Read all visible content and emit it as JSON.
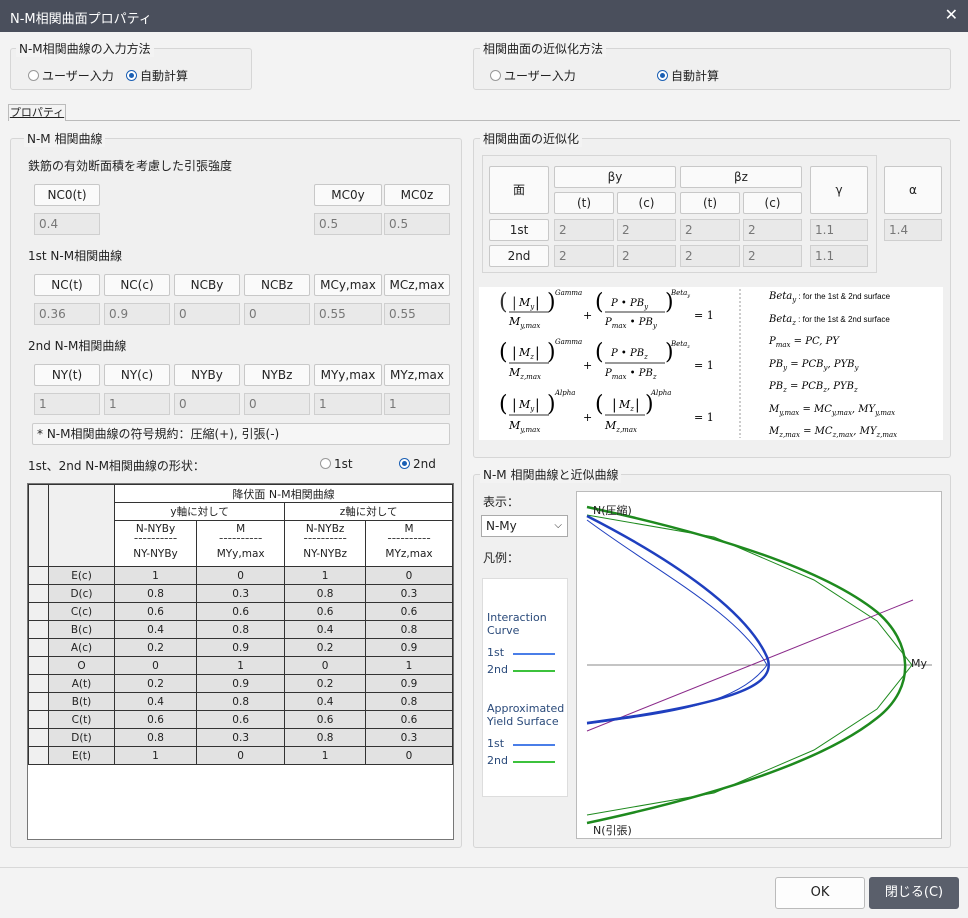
{
  "window": {
    "title": "N-M相関曲面プロパティ",
    "close_glyph": "✕"
  },
  "input_method": {
    "legend": "N-M相関曲線の入力方法",
    "opt_user": "ユーザー入力",
    "opt_auto": "自動計算"
  },
  "approx_method": {
    "legend": "相関曲面の近似化方法",
    "opt_user": "ユーザー入力",
    "opt_auto": "自動計算"
  },
  "tab": {
    "label": "プロパティ"
  },
  "nm_curve": {
    "legend": "N-M 相関曲線",
    "tension_label": "鉄筋の有効断面積を考慮した引張強度",
    "tension_headers": [
      "NC0(t)",
      "MC0y",
      "MC0z"
    ],
    "tension_values": [
      "0.4",
      "0.5",
      "0.5"
    ],
    "first_label": "1st N-M相関曲線",
    "first_headers": [
      "NC(t)",
      "NC(c)",
      "NCBy",
      "NCBz",
      "MCy,max",
      "MCz,max"
    ],
    "first_values": [
      "0.36",
      "0.9",
      "0",
      "0",
      "0.55",
      "0.55"
    ],
    "second_label": "2nd N-M相関曲線",
    "second_headers": [
      "NY(t)",
      "NY(c)",
      "NYBy",
      "NYBz",
      "MYy,max",
      "MYz,max"
    ],
    "second_values": [
      "1",
      "1",
      "0",
      "0",
      "1",
      "1"
    ],
    "sign_note": "* N-M相関曲線の符号規約：圧縮(+),  引張(-)",
    "shape_label": "1st、2nd N-M相関曲線の形状：",
    "shape_opt1": "1st",
    "shape_opt2": "2nd"
  },
  "table": {
    "title": "降伏面 N-M相関曲線",
    "y_axis": "y軸に対して",
    "z_axis": "z軸に対して",
    "col1_top": "N-NYBy",
    "col1_bot": "NY-NYBy",
    "col2_top": "M",
    "col2_bot": "MYy,max",
    "col3_top": "N-NYBz",
    "col3_bot": "NY-NYBz",
    "col4_top": "M",
    "col4_bot": "MYz,max",
    "dashes": "----------",
    "rows": [
      {
        "label": "E(c)",
        "v": [
          "1",
          "0",
          "1",
          "0"
        ]
      },
      {
        "label": "D(c)",
        "v": [
          "0.8",
          "0.3",
          "0.8",
          "0.3"
        ]
      },
      {
        "label": "C(c)",
        "v": [
          "0.6",
          "0.6",
          "0.6",
          "0.6"
        ]
      },
      {
        "label": "B(c)",
        "v": [
          "0.4",
          "0.8",
          "0.4",
          "0.8"
        ]
      },
      {
        "label": "A(c)",
        "v": [
          "0.2",
          "0.9",
          "0.2",
          "0.9"
        ]
      },
      {
        "label": "O",
        "v": [
          "0",
          "1",
          "0",
          "1"
        ]
      },
      {
        "label": "A(t)",
        "v": [
          "0.2",
          "0.9",
          "0.2",
          "0.9"
        ]
      },
      {
        "label": "B(t)",
        "v": [
          "0.4",
          "0.8",
          "0.4",
          "0.8"
        ]
      },
      {
        "label": "C(t)",
        "v": [
          "0.6",
          "0.6",
          "0.6",
          "0.6"
        ]
      },
      {
        "label": "D(t)",
        "v": [
          "0.8",
          "0.3",
          "0.8",
          "0.3"
        ]
      },
      {
        "label": "E(t)",
        "v": [
          "1",
          "0",
          "1",
          "0"
        ]
      }
    ]
  },
  "approx": {
    "legend": "相関曲面の近似化",
    "face": "面",
    "by": "βy",
    "bz": "βz",
    "gamma": "γ",
    "alpha": "α",
    "t": "(t)",
    "c": "(c)",
    "row1_label": "1st",
    "row2_label": "2nd",
    "row1": [
      "2",
      "2",
      "2",
      "2",
      "1.1"
    ],
    "row2": [
      "2",
      "2",
      "2",
      "2",
      "1.1"
    ],
    "alpha_val": "1.4"
  },
  "formula": {
    "eq_rhs": "= 1",
    "gamma": "Gamma",
    "alpha": "Alpha",
    "defs": [
      {
        "sym": "Beta",
        "sub": "y",
        "txt": ": for the 1st & 2nd surface"
      },
      {
        "sym": "Beta",
        "sub": "z",
        "txt": ": for the 1st & 2nd surface"
      }
    ],
    "def3": "P",
    "def3_sub": "max",
    "def3_rhs": "= PC,  PY",
    "def4": "PB",
    "def4_sub": "y",
    "def4_rhs": "= PCB",
    "def5": "PB",
    "def5_sub": "z",
    "def5_rhs": "= PCB",
    "def6": "M",
    "def6_sub": "y,max",
    "def6_rhs": "= MC",
    "def7": "M",
    "def7_sub": "z,max",
    "def7_rhs": "= MC"
  },
  "plot": {
    "legend": "N-M 相関曲線と近似曲線",
    "display_label": "表示：",
    "display_value": "N-My",
    "legend_label": "凡例：",
    "interaction": "Interaction Curve",
    "approximated": "Approximated Yield Surface",
    "first": "1st",
    "second": "2nd",
    "top_label": "N(圧縮)",
    "bottom_label": "N(引張)",
    "right_label": "My",
    "color_1st": "#1f3fbf",
    "color_2nd": "#1e8a1e",
    "legend_blue": "#4a7ee8",
    "legend_green": "#3cc23c"
  },
  "buttons": {
    "ok": "OK",
    "close": "閉じる(C)"
  }
}
